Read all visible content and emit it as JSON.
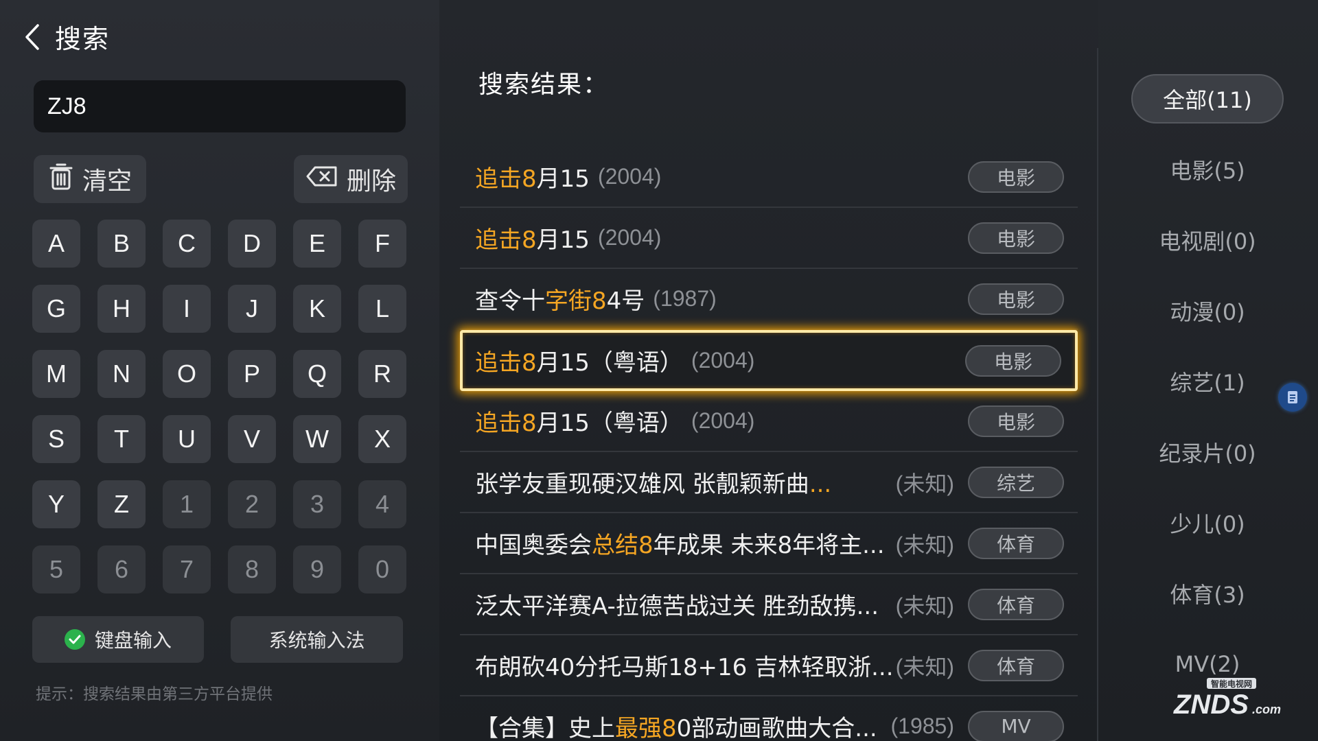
{
  "header": {
    "title": "搜索",
    "back_icon": "chevron-left-icon"
  },
  "search": {
    "value": "ZJ8"
  },
  "actions": {
    "clear_label": "清空",
    "delete_label": "删除"
  },
  "keyboard": {
    "letters": [
      "A",
      "B",
      "C",
      "D",
      "E",
      "F",
      "G",
      "H",
      "I",
      "J",
      "K",
      "L",
      "M",
      "N",
      "O",
      "P",
      "Q",
      "R",
      "S",
      "T",
      "U",
      "V",
      "W",
      "X",
      "Y",
      "Z"
    ],
    "digits": [
      "1",
      "2",
      "3",
      "4",
      "5",
      "6",
      "7",
      "8",
      "9",
      "0"
    ]
  },
  "input_methods": {
    "keyboard_label": "键盘输入",
    "system_label": "系统输入法"
  },
  "hint": "提示：搜索结果由第三方平台提供",
  "results": {
    "title": "搜索结果：",
    "items": [
      {
        "hl": "追击8",
        "rest": "月15",
        "year": "(2004)",
        "tag": "电影"
      },
      {
        "hl": "追击8",
        "rest": "月15",
        "year": "(2004)",
        "tag": "电影"
      },
      {
        "pre": "查令十",
        "hl": "字街8",
        "rest": "4号",
        "year": "(1987)",
        "tag": "电影"
      },
      {
        "hl": "追击8",
        "rest": "月15（粤语）",
        "year": "(2004)",
        "tag": "电影",
        "focused": true
      },
      {
        "hl": "追击8",
        "rest": "月15（粤语）",
        "year": "(2004)",
        "tag": "电影"
      },
      {
        "pre": "张学友重现硬汉雄风 张靓颖新曲",
        "hl": "...",
        "rest": "",
        "year": "(未知)",
        "tag": "综艺"
      },
      {
        "pre": "中国奥委会",
        "hl": "总结8",
        "rest": "年成果 未来8年将主...",
        "year": "(未知)",
        "tag": "体育"
      },
      {
        "pre": "泛太平洋赛A-拉德苦战过关 胜劲敌携...",
        "hl": "",
        "rest": "",
        "year": "(未知)",
        "tag": "体育"
      },
      {
        "pre": "布朗砍40分托马斯18+16 吉林轻取浙...",
        "hl": "",
        "rest": "",
        "year": "(未知)",
        "tag": "体育"
      },
      {
        "pre": "【合集】史上",
        "hl": "最强8",
        "rest": "0部动画歌曲大合...",
        "year": "(1985)",
        "tag": "MV"
      }
    ]
  },
  "categories": [
    {
      "label": "全部(11)",
      "active": true
    },
    {
      "label": "电影(5)"
    },
    {
      "label": "电视剧(0)"
    },
    {
      "label": "动漫(0)"
    },
    {
      "label": "综艺(1)"
    },
    {
      "label": "纪录片(0)"
    },
    {
      "label": "少儿(0)"
    },
    {
      "label": "体育(3)"
    },
    {
      "label": "MV(2)"
    }
  ],
  "watermark": {
    "top": "智能电视网",
    "brand": "ZNDS",
    "suffix": ".com"
  },
  "colors": {
    "highlight": "#f5a623",
    "focus_glow": "#ffaa00",
    "check": "#2bb24c"
  }
}
